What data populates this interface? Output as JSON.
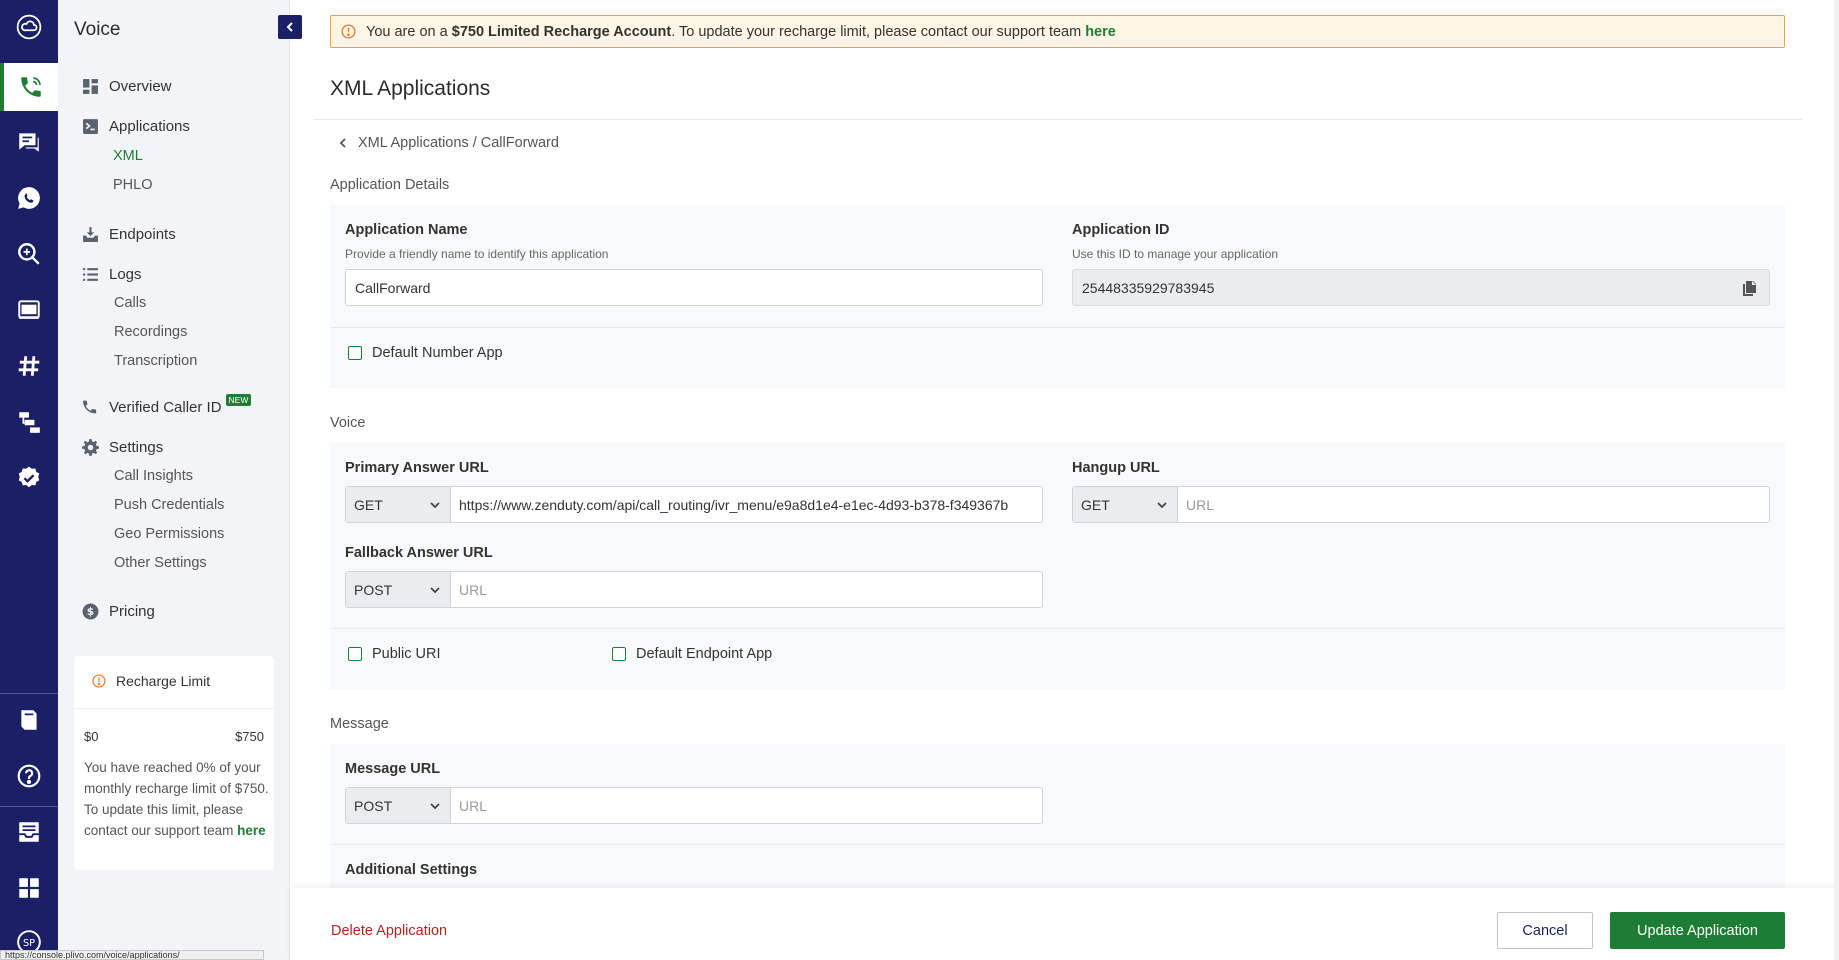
{
  "rail": {
    "items": [
      {
        "name": "cloud-logo-icon",
        "active": false
      },
      {
        "name": "voice-phone-icon",
        "active": true
      },
      {
        "name": "messaging-icon",
        "active": false
      },
      {
        "name": "whatsapp-icon",
        "active": false
      },
      {
        "name": "lookup-icon",
        "active": false
      },
      {
        "name": "sip-icon",
        "active": false
      },
      {
        "name": "numbers-hash-icon",
        "active": false
      },
      {
        "name": "phlo-flow-icon",
        "active": false
      },
      {
        "name": "verify-badge-icon",
        "active": false
      },
      {
        "name": "docs-book-icon",
        "active": false
      },
      {
        "name": "help-icon",
        "active": false
      },
      {
        "name": "support-inbox-icon",
        "active": false
      },
      {
        "name": "apps-grid-icon",
        "active": false
      },
      {
        "name": "account-avatar-icon",
        "active": false
      }
    ],
    "avatar_initials": "SP"
  },
  "sidebar": {
    "title": "Voice",
    "overview": "Overview",
    "applications": "Applications",
    "xml": "XML",
    "phlo": "PHLO",
    "endpoints": "Endpoints",
    "logs": "Logs",
    "calls": "Calls",
    "recordings": "Recordings",
    "transcription": "Transcription",
    "verified_caller_id": "Verified Caller ID",
    "new_badge": "NEW",
    "settings": "Settings",
    "call_insights": "Call Insights",
    "push_credentials": "Push Credentials",
    "geo_permissions": "Geo Permissions",
    "other_settings": "Other Settings",
    "pricing": "Pricing"
  },
  "recharge": {
    "title": "Recharge Limit",
    "min": "$0",
    "max": "$750",
    "used_fraction": 0,
    "text": "You have reached 0% of your monthly recharge limit of $750. To update this limit, please contact our support team",
    "link": "here"
  },
  "alert": {
    "prefix": "You are on a",
    "bold": "$750 Limited Recharge Account",
    "suffix": ". To update your recharge limit, please contact our support team",
    "link": "here"
  },
  "page": {
    "title": "XML Applications",
    "breadcrumb": "XML Applications / CallForward"
  },
  "details": {
    "section": "Application Details",
    "name_label": "Application Name",
    "name_hint": "Provide a friendly name to identify this application",
    "name_value": "CallForward",
    "id_label": "Application ID",
    "id_hint": "Use this ID to manage your application",
    "id_value": "25448335929783945",
    "default_number_app": "Default Number App"
  },
  "voice": {
    "section": "Voice",
    "primary_label": "Primary Answer URL",
    "primary_method": "GET",
    "primary_url": "https://www.zenduty.com/api/call_routing/ivr_menu/e9a8d1e4-e1ec-4d93-b378-f349367b",
    "hangup_label": "Hangup URL",
    "hangup_method": "GET",
    "hangup_placeholder": "URL",
    "fallback_label": "Fallback Answer URL",
    "fallback_method": "POST",
    "fallback_placeholder": "URL",
    "public_uri": "Public URI",
    "default_endpoint_app": "Default Endpoint App"
  },
  "message": {
    "section": "Message",
    "url_label": "Message URL",
    "method": "POST",
    "placeholder": "URL",
    "additional": "Additional Settings"
  },
  "footer": {
    "delete": "Delete Application",
    "cancel": "Cancel",
    "update": "Update Application"
  },
  "status_bar": {
    "url": "https://console.plivo.com/voice/applications/"
  },
  "colors": {
    "rail": "#1b1f66",
    "accent_green": "#1e7d34",
    "danger": "#b3261e",
    "alert_border": "#e8a33d"
  }
}
